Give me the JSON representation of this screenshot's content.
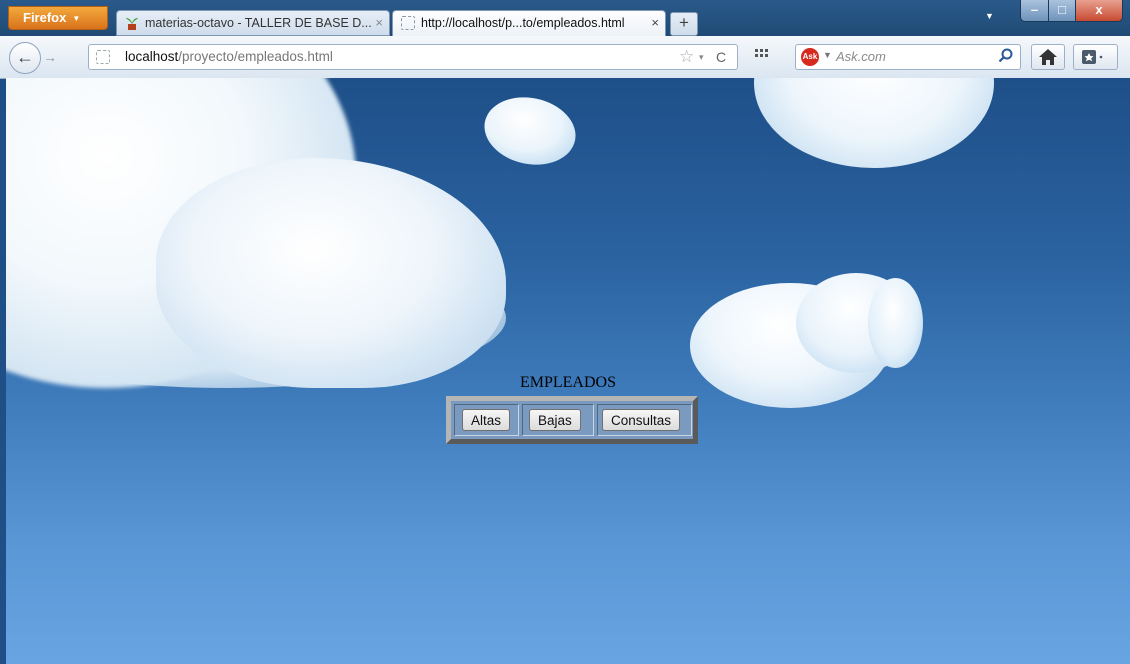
{
  "browser": {
    "menu_label": "Firefox",
    "tabs": [
      {
        "title": "materias-octavo - TALLER DE BASE D...",
        "close": "×",
        "active": false
      },
      {
        "title": "http://localhost/p...to/empleados.html",
        "close": "×",
        "active": true
      }
    ],
    "new_tab": "+",
    "window_buttons": {
      "minimize": "–",
      "maximize": "□",
      "close": "x"
    },
    "nav": {
      "back": "←",
      "forward": "→",
      "url_host": "localhost",
      "url_path": "/proyecto/empleados.html",
      "bookmark_star": "☆",
      "dropdown": "▾",
      "reload": "C"
    },
    "search": {
      "engine_logo": "Ask",
      "placeholder": "Ask.com"
    }
  },
  "page": {
    "title": "EMPLEADOS",
    "buttons": [
      {
        "label": "Altas"
      },
      {
        "label": "Bajas"
      },
      {
        "label": "Consultas"
      }
    ]
  },
  "colors": {
    "sky_top": "#1e4f88",
    "sky_bottom": "#69a4e2",
    "table_bg": "#7a9ac0",
    "firefox_orange": "#e8891f"
  }
}
